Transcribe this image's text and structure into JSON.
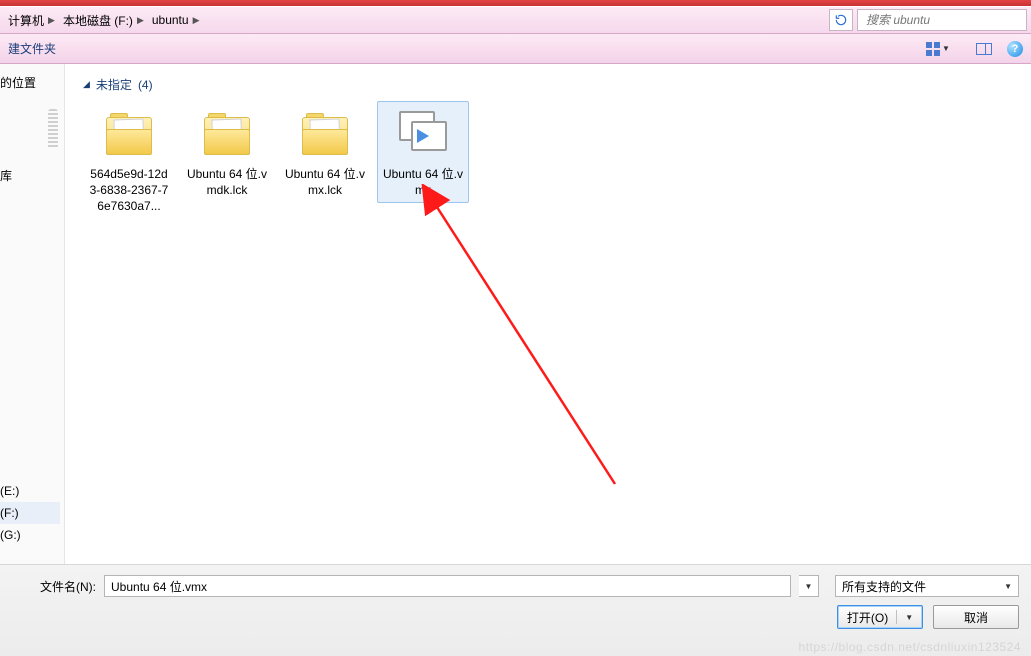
{
  "breadcrumbs": [
    {
      "label": "计算机"
    },
    {
      "label": "本地磁盘 (F:)"
    },
    {
      "label": "ubuntu"
    }
  ],
  "search": {
    "placeholder": "搜索 ubuntu"
  },
  "toolbar": {
    "new_folder": "建文件夹"
  },
  "sidebar": {
    "favorites_item": "的位置",
    "libraries_item": "库",
    "drives": [
      {
        "label": "(E:)"
      },
      {
        "label": "(F:)",
        "selected": true
      },
      {
        "label": "(G:)"
      }
    ]
  },
  "content": {
    "group_name": "未指定",
    "group_count": "(4)",
    "items": [
      {
        "name": "564d5e9d-12d3-6838-2367-76e7630a7...",
        "type": "folder"
      },
      {
        "name": "Ubuntu 64 位.vmdk.lck",
        "type": "folder"
      },
      {
        "name": "Ubuntu 64 位.vmx.lck",
        "type": "folder"
      },
      {
        "name": "Ubuntu 64 位.vmx",
        "type": "vmx",
        "selected": true
      }
    ]
  },
  "bottom": {
    "filename_label": "文件名(N):",
    "filename_value": "Ubuntu 64 位.vmx",
    "filter_label": "所有支持的文件",
    "open_label": "打开(O)",
    "cancel_label": "取消"
  },
  "watermark": "https://blog.csdn.net/csdnliuxin123524"
}
